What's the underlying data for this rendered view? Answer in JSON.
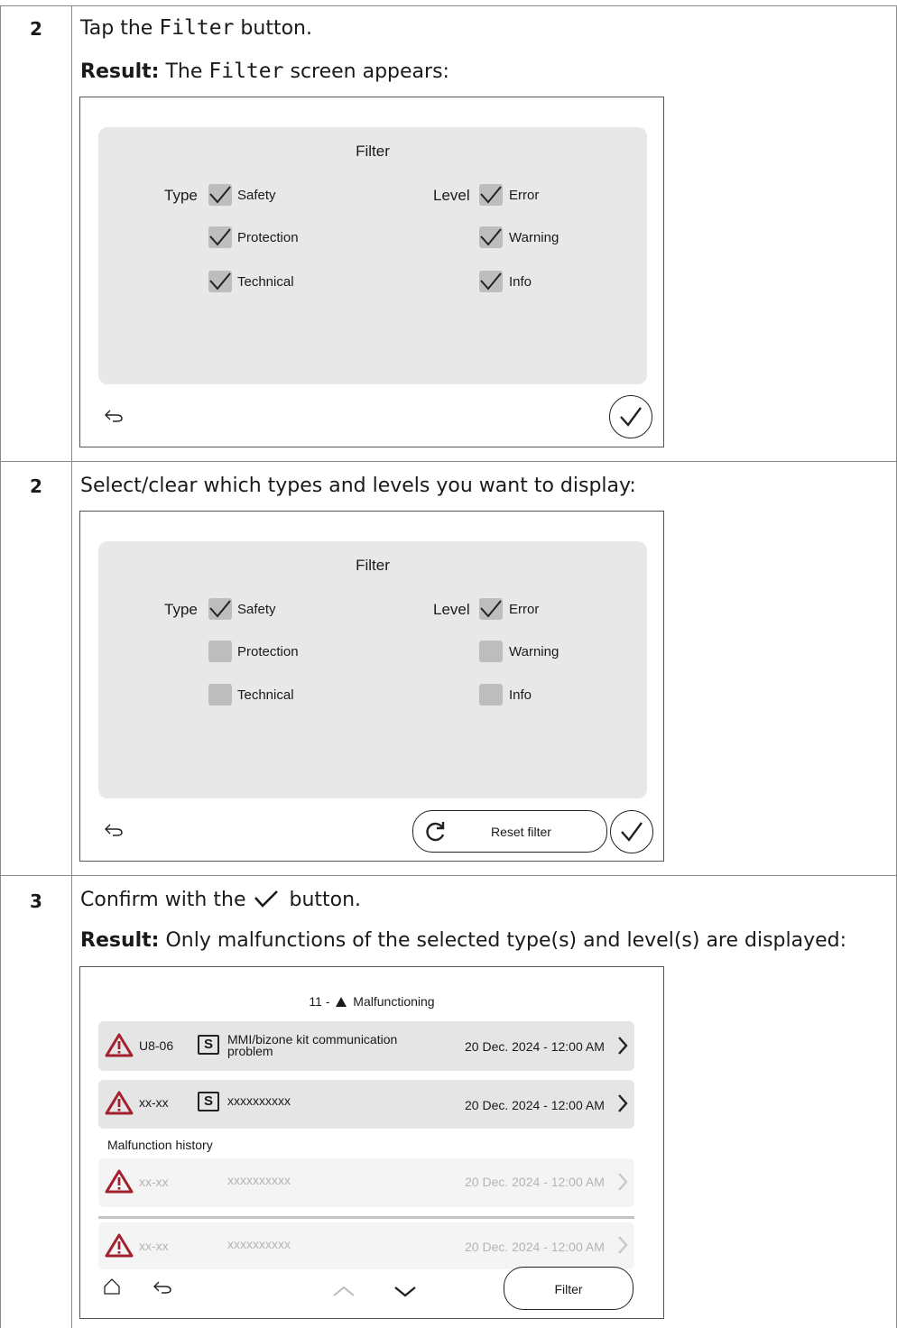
{
  "steps": [
    {
      "number": "2",
      "instruction": {
        "pre": "Tap the ",
        "code": "Filter",
        "post": " button."
      },
      "result": {
        "label": "Result:",
        "pre": " The ",
        "code": "Filter",
        "post": " screen appears:"
      },
      "screen": {
        "title": "Filter",
        "type_label": "Type",
        "level_label": "Level",
        "type_options": [
          {
            "label": "Safety",
            "checked": true
          },
          {
            "label": "Protection",
            "checked": true
          },
          {
            "label": "Technical",
            "checked": true
          }
        ],
        "level_options": [
          {
            "label": "Error",
            "checked": true
          },
          {
            "label": "Warning",
            "checked": true
          },
          {
            "label": "Info",
            "checked": true
          }
        ]
      }
    },
    {
      "number": "2",
      "instruction": {
        "text": "Select/clear which types and levels you want to display:"
      },
      "screen": {
        "title": "Filter",
        "type_label": "Type",
        "level_label": "Level",
        "type_options": [
          {
            "label": "Safety",
            "checked": true
          },
          {
            "label": "Protection",
            "checked": false
          },
          {
            "label": "Technical",
            "checked": false
          }
        ],
        "level_options": [
          {
            "label": "Error",
            "checked": true
          },
          {
            "label": "Warning",
            "checked": false
          },
          {
            "label": "Info",
            "checked": false
          }
        ],
        "reset_label": "Reset filter"
      }
    },
    {
      "number": "3",
      "instruction": {
        "pre": "Confirm with the ",
        "post": " button."
      },
      "result": {
        "label": "Result:",
        "text": " Only malfunctions of the selected type(s) and level(s) are displayed:"
      },
      "screen": {
        "header": {
          "count": "11 -",
          "title": "Malfunctioning"
        },
        "active": [
          {
            "code": "U8-06",
            "badge": "S",
            "desc_line1": "MMI/bizone kit communication",
            "desc_line2": "problem",
            "date": "20 Dec. 2024 - 12:00 AM"
          },
          {
            "code": "xx-xx",
            "badge": "S",
            "desc_line1": "xxxxxxxxxx",
            "desc_line2": "",
            "date": "20 Dec. 2024 - 12:00 AM"
          }
        ],
        "history_label": "Malfunction history",
        "history": [
          {
            "code": "xx-xx",
            "desc": "xxxxxxxxxx",
            "date": "20 Dec. 2024 - 12:00 AM"
          },
          {
            "code": "xx-xx",
            "desc": "xxxxxxxxxx",
            "date": "20 Dec. 2024 - 12:00 AM"
          }
        ],
        "filter_label": "Filter"
      }
    }
  ],
  "colors": {
    "warning_red": "#a3212e",
    "panel_grey": "#e8e8e8",
    "checkbox_grey": "#bdbdbd"
  }
}
